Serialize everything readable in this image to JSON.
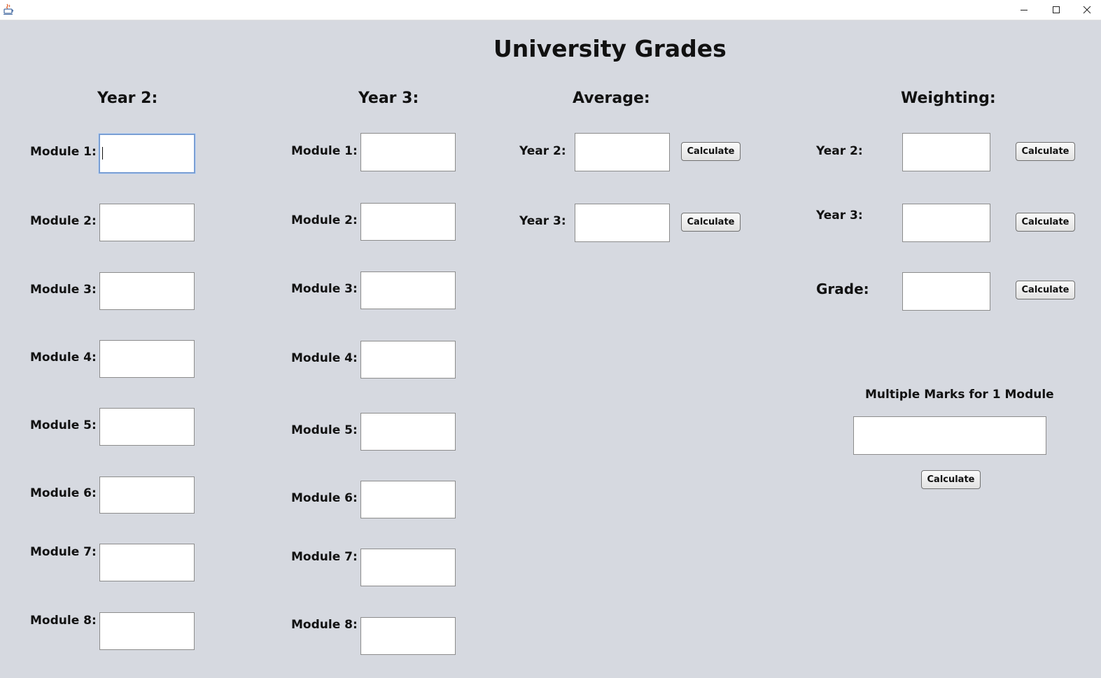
{
  "window": {
    "controls": {
      "minimize": "–",
      "maximize": "☐",
      "close": "✕"
    }
  },
  "title": "University Grades",
  "columns": {
    "year2": "Year 2:",
    "year3": "Year 3:",
    "average": "Average:",
    "weighting": "Weighting:"
  },
  "year2_modules": [
    {
      "label": "Module 1:",
      "value": ""
    },
    {
      "label": "Module 2:",
      "value": ""
    },
    {
      "label": "Module 3:",
      "value": ""
    },
    {
      "label": "Module 4:",
      "value": ""
    },
    {
      "label": "Module 5:",
      "value": ""
    },
    {
      "label": "Module 6:",
      "value": ""
    },
    {
      "label": "Module 7:",
      "value": ""
    },
    {
      "label": "Module 8:",
      "value": ""
    }
  ],
  "year3_modules": [
    {
      "label": "Module 1:",
      "value": ""
    },
    {
      "label": "Module 2:",
      "value": ""
    },
    {
      "label": "Module 3:",
      "value": ""
    },
    {
      "label": "Module 4:",
      "value": ""
    },
    {
      "label": "Module 5:",
      "value": ""
    },
    {
      "label": "Module 6:",
      "value": ""
    },
    {
      "label": "Module 7:",
      "value": ""
    },
    {
      "label": "Module 8:",
      "value": ""
    }
  ],
  "average": {
    "year2_label": "Year 2:",
    "year3_label": "Year 3:",
    "year2_value": "",
    "year3_value": "",
    "calculate_label": "Calculate"
  },
  "weighting": {
    "year2_label": "Year 2:",
    "year3_label": "Year 3:",
    "grade_label": "Grade:",
    "year2_value": "",
    "year3_value": "",
    "grade_value": "",
    "calculate_label": "Calculate"
  },
  "multiple_marks": {
    "heading": "Multiple Marks for 1 Module",
    "value": "",
    "calculate_label": "Calculate"
  }
}
